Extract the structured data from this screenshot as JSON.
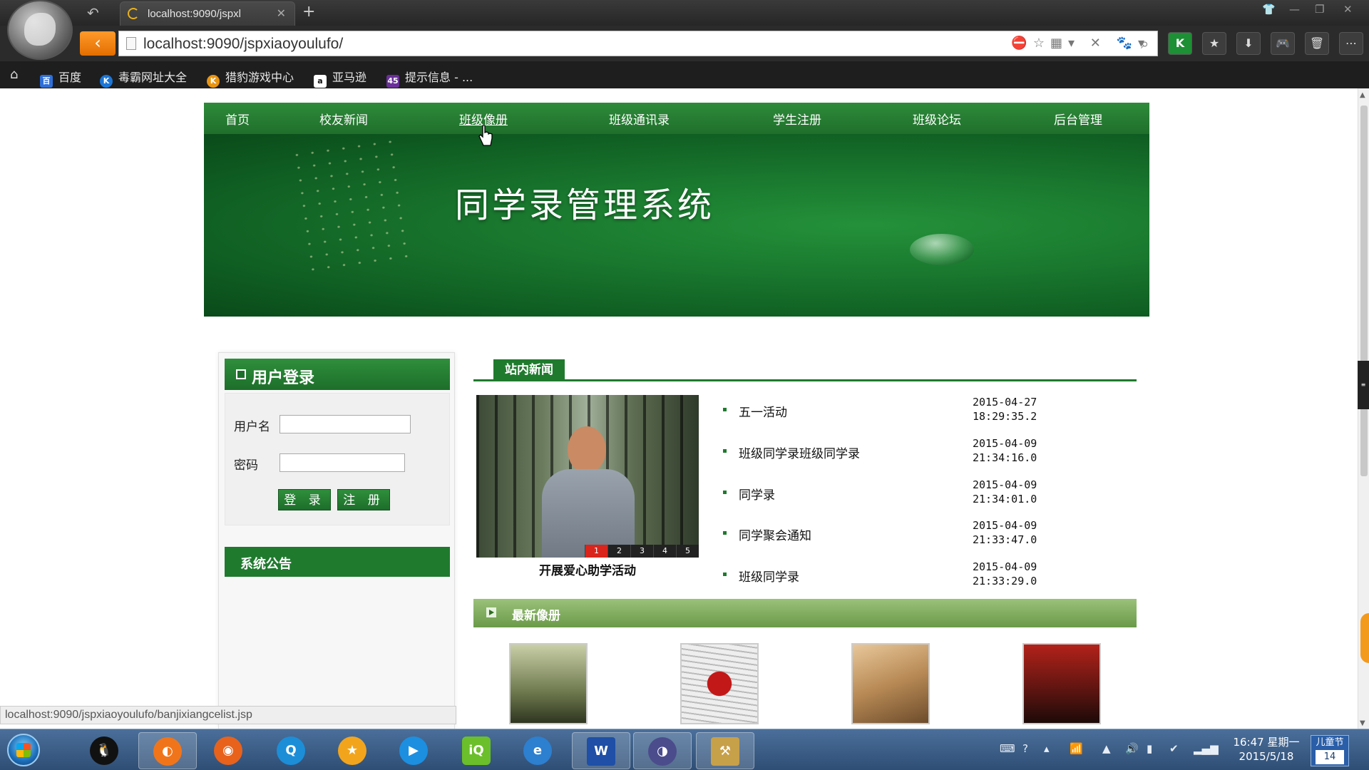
{
  "browser": {
    "tab_title": "localhost:9090/jspxl",
    "url": "localhost:9090/jspxiaoyoulufo/",
    "bookmarks": [
      "百度",
      "毒霸网址大全",
      "猎豹游戏中心",
      "亚马逊",
      "提示信息 - ..."
    ],
    "status_url": "localhost:9090/jspxiaoyoulufo/banjixiangcelist.jsp"
  },
  "site": {
    "nav": [
      "首页",
      "校友新闻",
      "班级像册",
      "班级通讯录",
      "学生注册",
      "班级论坛",
      "后台管理"
    ],
    "banner_title": "同学录管理系统"
  },
  "login": {
    "header": "用户登录",
    "username_label": "用户名",
    "password_label": "密码",
    "login_button": "登 录",
    "register_button": "注 册",
    "notice_header": "系统公告"
  },
  "news": {
    "tab_label": "站内新闻",
    "photo_caption": "开展爱心助学活动",
    "slide_numbers": [
      "1",
      "2",
      "3",
      "4",
      "5"
    ],
    "items": [
      {
        "title": "五一活动",
        "date": "2015-04-27",
        "time": "18:29:35.2"
      },
      {
        "title": "班级同学录班级同学录",
        "date": "2015-04-09",
        "time": "21:34:16.0"
      },
      {
        "title": "同学录",
        "date": "2015-04-09",
        "time": "21:34:01.0"
      },
      {
        "title": "同学聚会通知",
        "date": "2015-04-09",
        "time": "21:33:47.0"
      },
      {
        "title": "班级同学录",
        "date": "2015-04-09",
        "time": "21:33:29.0"
      }
    ]
  },
  "albums": {
    "header": "最新像册"
  },
  "taskbar": {
    "time": "16:47 星期一",
    "date": "2015/5/18",
    "holiday": "儿童节",
    "holiday_day": "14"
  },
  "colors": {
    "primary_green": "#1f7a2e",
    "album_bar_green": "#7aa857",
    "nav_back_orange": "#f28a10"
  }
}
